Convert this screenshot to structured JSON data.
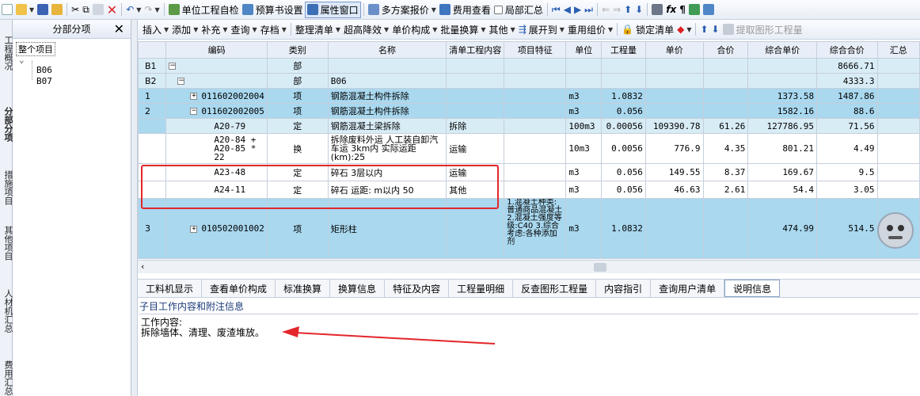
{
  "toolbar1": {
    "items": [
      "单位工程自检",
      "预算书设置",
      "属性窗口",
      "多方案报价",
      "费用查看",
      "局部汇总"
    ]
  },
  "left_tabs": [
    "工程概况",
    "分部分项",
    "措施项目",
    "其他项目",
    "人材机汇总",
    "费用汇总"
  ],
  "tree": {
    "header": "分部分项",
    "root": "整个项目",
    "children": [
      "B06",
      "B07"
    ]
  },
  "toolbar2": {
    "items": [
      "插入",
      "添加",
      "补充",
      "查询",
      "存档",
      "整理清单",
      "超高降效",
      "单价构成",
      "批量换算",
      "其他",
      "展开到",
      "重用组价",
      "锁定清单",
      "提取图形工程量"
    ]
  },
  "grid": {
    "headers": [
      "编码",
      "类别",
      "名称",
      "清单工程内容",
      "项目特征",
      "单位",
      "工程量",
      "单价",
      "合价",
      "综合单价",
      "综合合价",
      "汇总"
    ],
    "rows": [
      {
        "rn": "B1",
        "code": "",
        "type": "部",
        "name": "",
        "content": "",
        "feature": "",
        "unit": "",
        "qty": "",
        "price": "",
        "total": "",
        "comp_price": "",
        "comp_total": "8666.71"
      },
      {
        "rn": "B2",
        "code": "",
        "type": "部",
        "name": "B06",
        "content": "",
        "feature": "",
        "unit": "",
        "qty": "",
        "price": "",
        "total": "",
        "comp_price": "",
        "comp_total": "4333.3"
      },
      {
        "rn": "1",
        "code": "011602002004",
        "type": "项",
        "name": "钢筋混凝土构件拆除",
        "content": "",
        "feature": "",
        "unit": "m3",
        "qty": "1.0832",
        "price": "",
        "total": "",
        "comp_price": "1373.58",
        "comp_total": "1487.86"
      },
      {
        "rn": "2",
        "code": "011602002005",
        "type": "项",
        "name": "钢筋混凝土构件拆除",
        "content": "",
        "feature": "",
        "unit": "m3",
        "qty": "0.056",
        "price": "",
        "total": "",
        "comp_price": "1582.16",
        "comp_total": "88.6"
      },
      {
        "rn": "",
        "code": "A20-79",
        "type": "定",
        "name": "钢筋混凝土梁拆除",
        "content": "拆除",
        "feature": "",
        "unit": "100m3",
        "qty": "0.00056",
        "price": "109390.78",
        "total": "61.26",
        "comp_price": "127786.95",
        "comp_total": "71.56"
      },
      {
        "rn": "",
        "code": "A20-84 + A20-85 * 22",
        "type": "换",
        "name": "拆除废料外运 人工装自卸汽车运 3km内 实际运距(km):25",
        "content": "运输",
        "feature": "",
        "unit": "10m3",
        "qty": "0.0056",
        "price": "776.9",
        "total": "4.35",
        "comp_price": "801.21",
        "comp_total": "4.49"
      },
      {
        "rn": "",
        "code": "A23-48",
        "type": "定",
        "name": "碎石 3层以内",
        "content": "运输",
        "feature": "",
        "unit": "m3",
        "qty": "0.056",
        "price": "149.55",
        "total": "8.37",
        "comp_price": "169.67",
        "comp_total": "9.5"
      },
      {
        "rn": "",
        "code": "A24-11",
        "type": "定",
        "name": "碎石 运距: m以内 50",
        "content": "其他",
        "feature": "",
        "unit": "m3",
        "qty": "0.056",
        "price": "46.63",
        "total": "2.61",
        "comp_price": "54.4",
        "comp_total": "3.05"
      },
      {
        "rn": "3",
        "code": "010502001002",
        "type": "项",
        "name": "矩形柱",
        "content": "",
        "feature": "1.混凝土种类:普通商品混凝土2.混凝土强度等级:C40 3.综合考虑:各种添加剂",
        "unit": "m3",
        "qty": "1.0832",
        "price": "",
        "total": "",
        "comp_price": "474.99",
        "comp_total": "514.5"
      }
    ]
  },
  "bottom_tabs": [
    "工料机显示",
    "查看单价构成",
    "标准换算",
    "换算信息",
    "特征及内容",
    "工程量明细",
    "反查图形工程量",
    "内容指引",
    "查询用户清单",
    "说明信息"
  ],
  "detail": {
    "subtitle": "子目工作内容和附注信息",
    "line1": "工作内容:",
    "line2": "拆除墙体、清理、废渣堆放。"
  },
  "colors": {
    "selected_row": "#a9d8ef",
    "light_row": "#d8ecf6",
    "annotation": "#e3262a"
  }
}
